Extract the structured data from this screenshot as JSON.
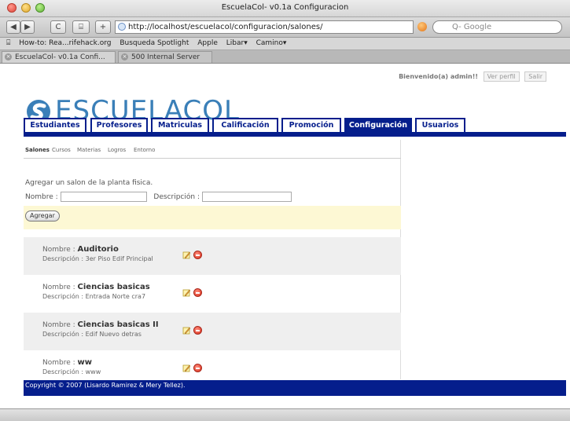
{
  "window": {
    "title": "EscuelaCol- v0.1a Configuracion"
  },
  "toolbar": {
    "back": "◀",
    "forward": "▶",
    "reload": "C",
    "bookmark_btn": "⌸",
    "add": "+",
    "url": "http://localhost/escuelacol/configuracion/salones/",
    "search_placeholder": "Q- Google"
  },
  "bookmarks": [
    "How-to: Rea...rifehack.org",
    "Busqueda Spotlight",
    "Apple",
    "Libar▾",
    "Camino▾"
  ],
  "browser_tabs": [
    "EscuelaCol- v0.1a Confi...",
    "500 Internal Server Error"
  ],
  "header": {
    "welcome": "Bienvenido(a) admin!!",
    "profile_btn": "Ver perfil",
    "logout_btn": "Salir",
    "logo": "ESCUELACOL"
  },
  "nav": {
    "tabs": [
      "Estudiantes",
      "Profesores",
      "Matriculas",
      "Calificación",
      "Promoción",
      "Configuración",
      "Usuarios"
    ],
    "active": "Configuración"
  },
  "subnav": {
    "tabs": [
      "Salones",
      "Cursos",
      "Materias",
      "Logros",
      "Entorno"
    ],
    "active": "Salones"
  },
  "form": {
    "title": "Agregar un salon de la planta fisica.",
    "name_label": "Nombre :",
    "desc_label": "Descripción :",
    "name_value": "",
    "desc_value": "",
    "submit": "Agregar"
  },
  "records": [
    {
      "name_label": "Nombre :",
      "name": "Auditorio",
      "desc_label": "Descripción :",
      "desc": "3er Piso Edif Principal"
    },
    {
      "name_label": "Nombre :",
      "name": "Ciencias basicas",
      "desc_label": "Descripción :",
      "desc": "Entrada Norte cra7"
    },
    {
      "name_label": "Nombre :",
      "name": "Ciencias basicas II",
      "desc_label": "Descripción :",
      "desc": "Edif Nuevo detras"
    },
    {
      "name_label": "Nombre :",
      "name": "ww",
      "desc_label": "Descripción :",
      "desc": "www"
    }
  ],
  "footer": {
    "text": "Copyright © 2007 (Lisardo Ramirez & Mery Tellez)."
  }
}
